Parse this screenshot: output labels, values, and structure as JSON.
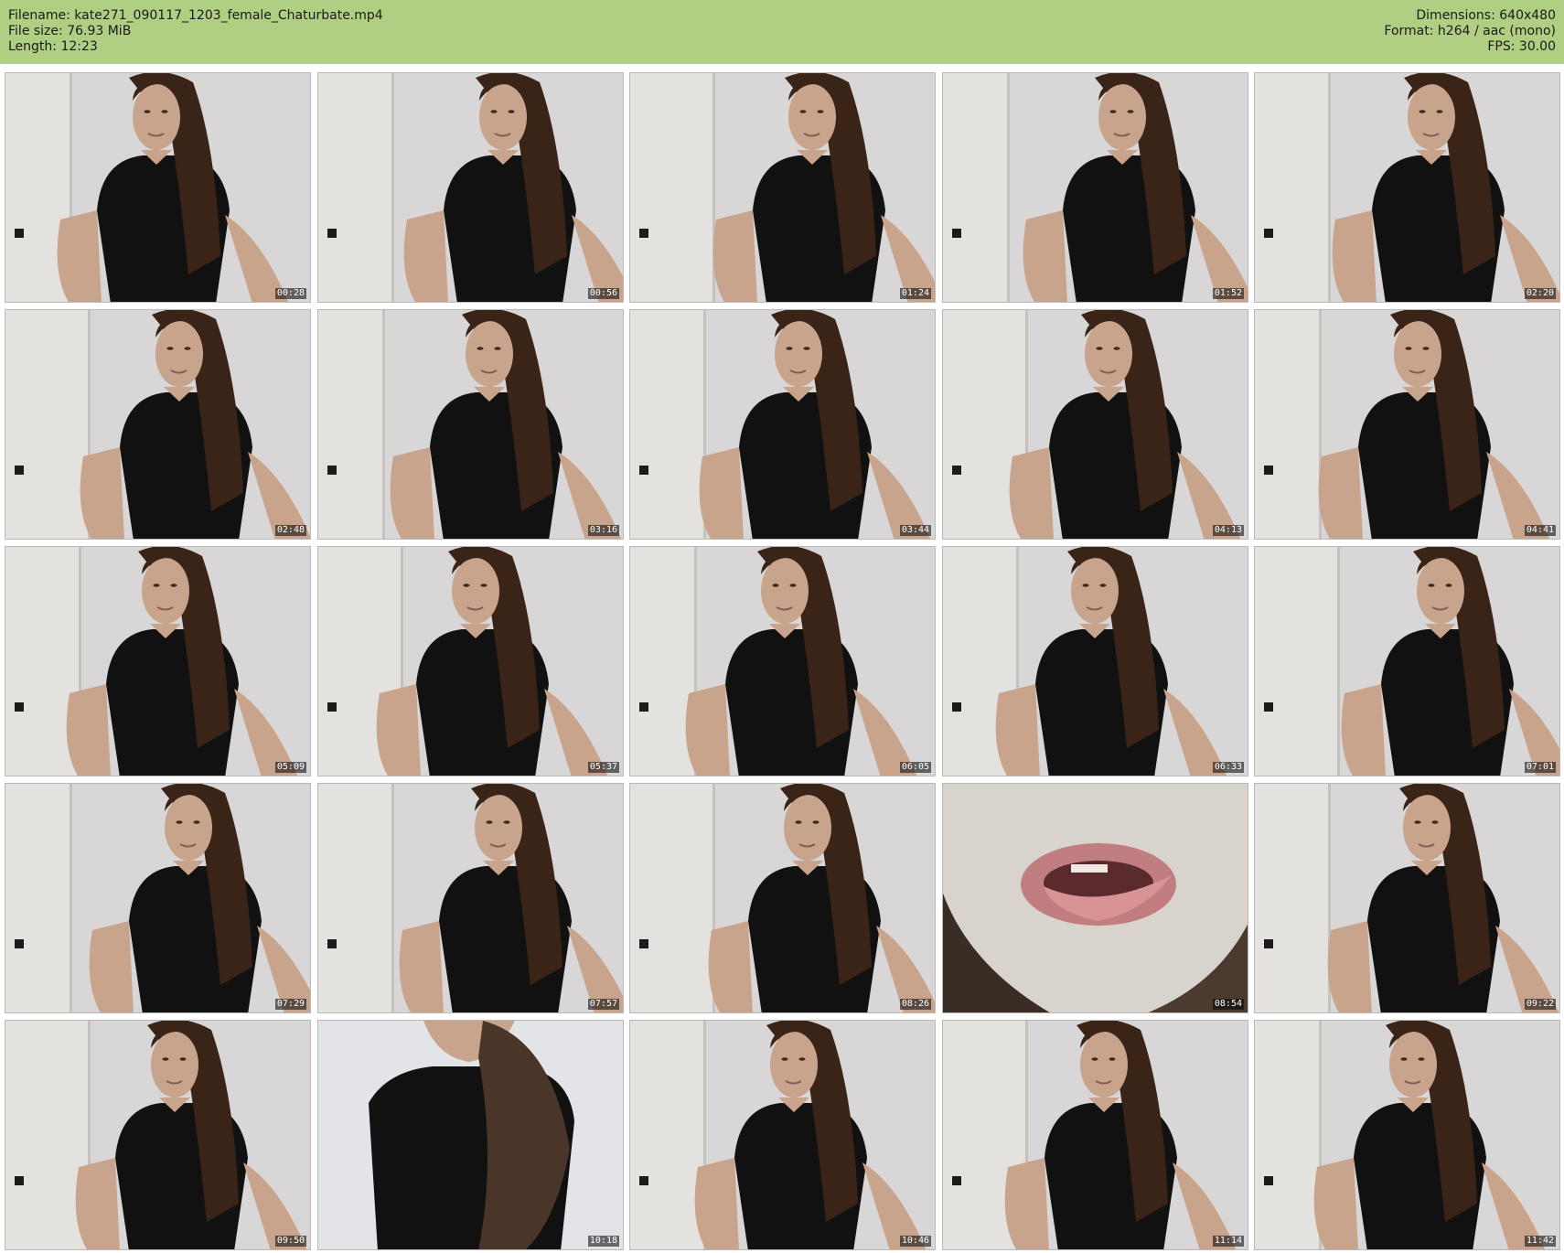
{
  "header": {
    "filename": "Filename: kate271_090117_1203_female_Chaturbate.mp4",
    "filesize": "File size: 76.93 MiB",
    "length": "Length: 12:23",
    "dimensions": "Dimensions: 640x480",
    "format": "Format: h264 / aac (mono)",
    "fps": "FPS: 30.00"
  },
  "thumbnails": [
    {
      "time": "00:28",
      "variant": "normal"
    },
    {
      "time": "00:56",
      "variant": "normal"
    },
    {
      "time": "01:24",
      "variant": "normal"
    },
    {
      "time": "01:52",
      "variant": "normal"
    },
    {
      "time": "02:20",
      "variant": "normal"
    },
    {
      "time": "02:48",
      "variant": "normal"
    },
    {
      "time": "03:16",
      "variant": "normal"
    },
    {
      "time": "03:44",
      "variant": "normal"
    },
    {
      "time": "04:13",
      "variant": "normal"
    },
    {
      "time": "04:41",
      "variant": "normal"
    },
    {
      "time": "05:09",
      "variant": "normal"
    },
    {
      "time": "05:37",
      "variant": "normal"
    },
    {
      "time": "06:05",
      "variant": "normal"
    },
    {
      "time": "06:33",
      "variant": "normal"
    },
    {
      "time": "07:01",
      "variant": "normal"
    },
    {
      "time": "07:29",
      "variant": "normal"
    },
    {
      "time": "07:57",
      "variant": "normal"
    },
    {
      "time": "08:26",
      "variant": "normal"
    },
    {
      "time": "08:54",
      "variant": "closeup"
    },
    {
      "time": "09:22",
      "variant": "normal"
    },
    {
      "time": "09:50",
      "variant": "normal"
    },
    {
      "time": "10:18",
      "variant": "close"
    },
    {
      "time": "10:46",
      "variant": "normal"
    },
    {
      "time": "11:14",
      "variant": "normal"
    },
    {
      "time": "11:42",
      "variant": "normal"
    }
  ],
  "colors": {
    "header_bg": "#b0cf82",
    "wall": "#d8d6d6",
    "shirt": "#111111",
    "hair": "#3a2418",
    "skin": "#c9a48c"
  }
}
